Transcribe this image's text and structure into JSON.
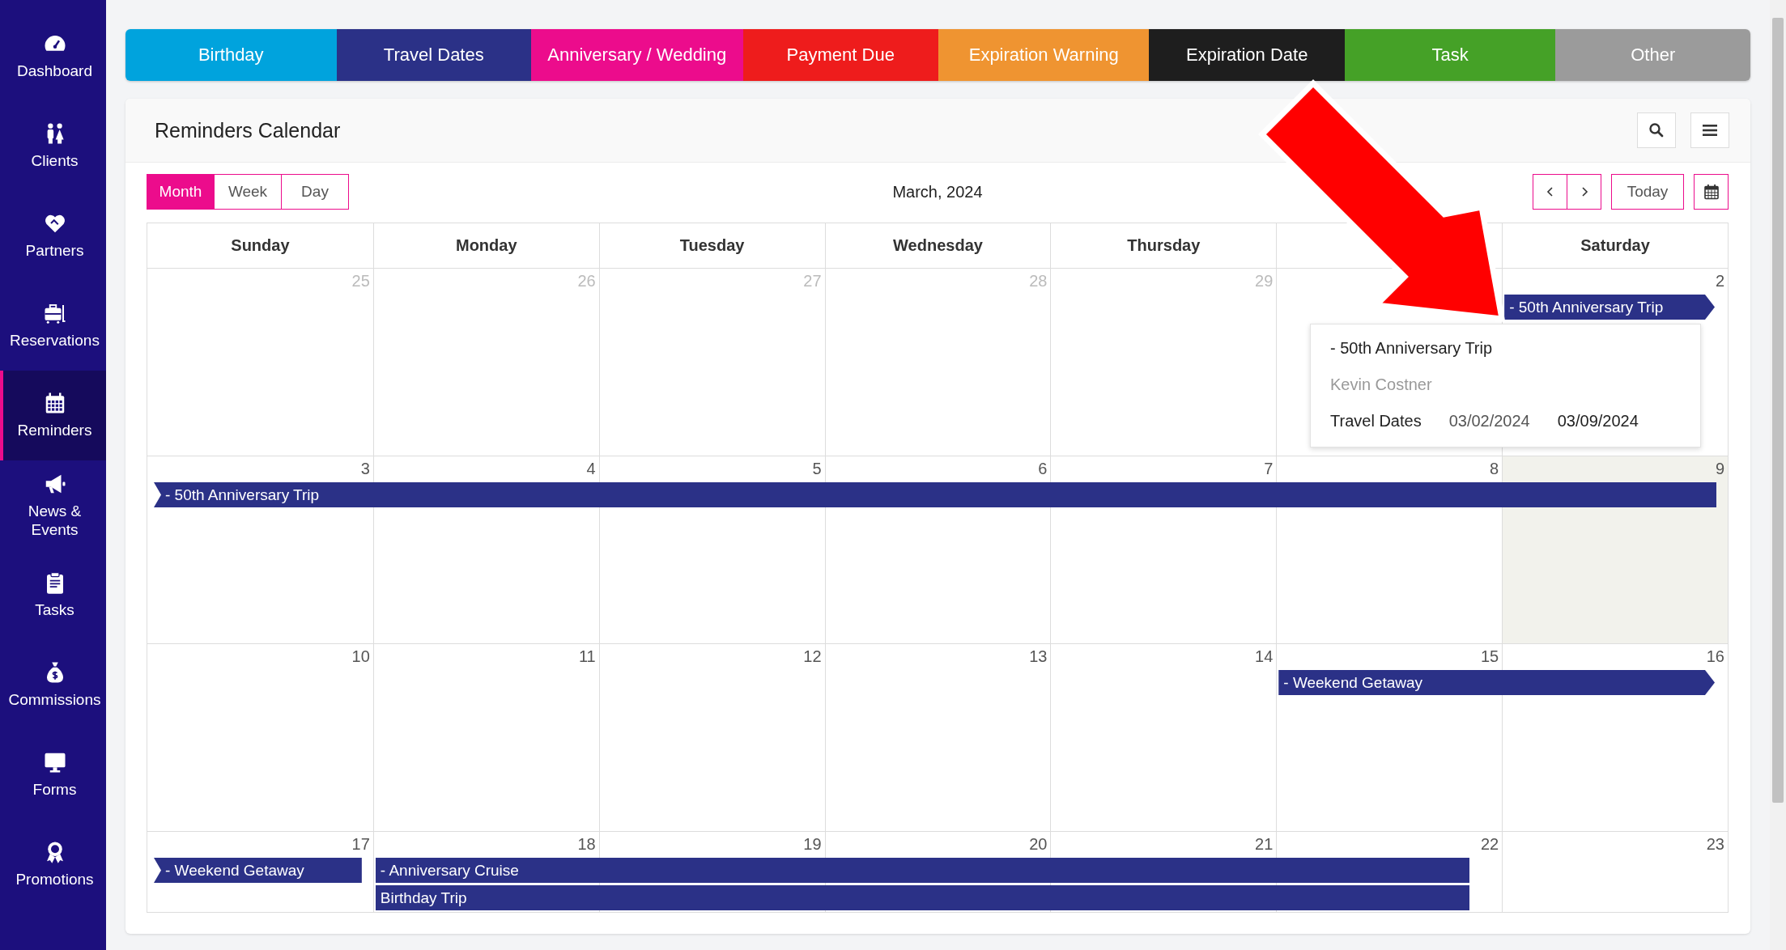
{
  "sidebar": {
    "items": [
      {
        "label": "Dashboard",
        "selected": false
      },
      {
        "label": "Clients",
        "selected": false
      },
      {
        "label": "Partners",
        "selected": false
      },
      {
        "label": "Reservations",
        "selected": false
      },
      {
        "label": "Reminders",
        "selected": true
      },
      {
        "label": "News & Events",
        "selected": false
      },
      {
        "label": "Tasks",
        "selected": false
      },
      {
        "label": "Commissions",
        "selected": false
      },
      {
        "label": "Forms",
        "selected": false
      },
      {
        "label": "Promotions",
        "selected": false
      }
    ]
  },
  "categories": [
    {
      "label": "Birthday",
      "color": "#00a3dd"
    },
    {
      "label": "Travel Dates",
      "color": "#2b3187"
    },
    {
      "label": "Anniversary / Wedding",
      "color": "#ec0c8c"
    },
    {
      "label": "Payment Due",
      "color": "#ee1c1c"
    },
    {
      "label": "Expiration Warning",
      "color": "#ef9431"
    },
    {
      "label": "Expiration Date",
      "color": "#1e1e1e"
    },
    {
      "label": "Task",
      "color": "#45a127"
    },
    {
      "label": "Other",
      "color": "#9b9b9b"
    }
  ],
  "calendar": {
    "title": "Reminders Calendar",
    "views": [
      {
        "label": "Month",
        "selected": true
      },
      {
        "label": "Week",
        "selected": false
      },
      {
        "label": "Day",
        "selected": false
      }
    ],
    "period": "March, 2024",
    "today_button": "Today",
    "weekdays": [
      "Sunday",
      "Monday",
      "Tuesday",
      "Wednesday",
      "Thursday",
      "Saturday"
    ],
    "weeks": [
      {
        "days": [
          {
            "number": "25",
            "other_month": true,
            "today": false
          },
          {
            "number": "26",
            "other_month": true,
            "today": false
          },
          {
            "number": "27",
            "other_month": true,
            "today": false
          },
          {
            "number": "28",
            "other_month": true,
            "today": false
          },
          {
            "number": "29",
            "other_month": true,
            "today": false
          },
          {
            "today": false
          },
          {
            "number": "2",
            "other_month": false,
            "today": false
          }
        ],
        "lanes": [
          [
            {
              "kind": "gap"
            },
            {
              "kind": "gap"
            },
            {
              "kind": "gap"
            },
            {
              "kind": "gap"
            },
            {
              "kind": "gap"
            },
            {
              "kind": "gap"
            },
            {
              "kind": "arrow",
              "title": "- 50th Anniversary Trip"
            }
          ]
        ]
      },
      {
        "days": [
          {
            "number": "3",
            "other_month": false,
            "today": false
          },
          {
            "number": "4",
            "other_month": false,
            "today": false
          },
          {
            "number": "5",
            "other_month": false,
            "today": false
          },
          {
            "number": "6",
            "other_month": false,
            "today": false
          },
          {
            "number": "7",
            "other_month": false,
            "today": false
          },
          {
            "number": "8",
            "other_month": false,
            "today": false
          },
          {
            "number": "9",
            "other_month": false,
            "today": true
          }
        ],
        "lanes": [
          [
            {
              "kind": "notch",
              "title": "- 50th Anniversary Trip"
            },
            {
              "kind": "more"
            },
            {
              "kind": "more"
            },
            {
              "kind": "more"
            },
            {
              "kind": "more"
            },
            {
              "kind": "more"
            },
            {
              "kind": "more"
            }
          ]
        ]
      },
      {
        "days": [
          {
            "number": "10",
            "other_month": false,
            "today": false
          },
          {
            "number": "11",
            "other_month": false,
            "today": false
          },
          {
            "number": "12",
            "other_month": false,
            "today": false
          },
          {
            "number": "13",
            "other_month": false,
            "today": false
          },
          {
            "number": "14",
            "other_month": false,
            "today": false
          },
          {
            "number": "15",
            "other_month": false,
            "today": false
          },
          {
            "number": "16",
            "other_month": false,
            "today": false
          }
        ],
        "lanes": [
          [
            {
              "kind": "gap"
            },
            {
              "kind": "gap"
            },
            {
              "kind": "gap"
            },
            {
              "kind": "gap"
            },
            {
              "kind": "gap"
            },
            {
              "kind": "arrow",
              "title": "- Weekend Getaway"
            },
            {
              "kind": "more"
            }
          ]
        ]
      },
      {
        "days": [
          {
            "number": "17",
            "other_month": false,
            "today": false
          },
          {
            "number": "18",
            "other_month": false,
            "today": false
          },
          {
            "number": "19",
            "other_month": false,
            "today": false
          },
          {
            "number": "20",
            "other_month": false,
            "today": false
          },
          {
            "number": "21",
            "other_month": false,
            "today": false
          },
          {
            "number": "22",
            "other_month": false,
            "today": false
          },
          {
            "number": "23",
            "other_month": false,
            "today": false
          }
        ],
        "lanes": [
          [
            {
              "kind": "notch",
              "title": "- Weekend Getaway"
            },
            {
              "kind": "plain",
              "title": "- Anniversary Cruise"
            },
            {
              "kind": "more"
            },
            {
              "kind": "more"
            },
            {
              "kind": "more"
            },
            {
              "kind": "more"
            },
            {
              "kind": "gap"
            }
          ],
          [
            {
              "kind": "gap"
            },
            {
              "kind": "plain",
              "title": "Birthday Trip"
            },
            {
              "kind": "more"
            },
            {
              "kind": "more"
            },
            {
              "kind": "more"
            },
            {
              "kind": "more"
            },
            {
              "kind": "gap"
            }
          ]
        ]
      }
    ],
    "tooltip": {
      "title": "- 50th Anniversary Trip",
      "client": "Kevin Costner",
      "category": "Travel Dates",
      "start": "03/02/2024",
      "end": "03/09/2024"
    }
  }
}
